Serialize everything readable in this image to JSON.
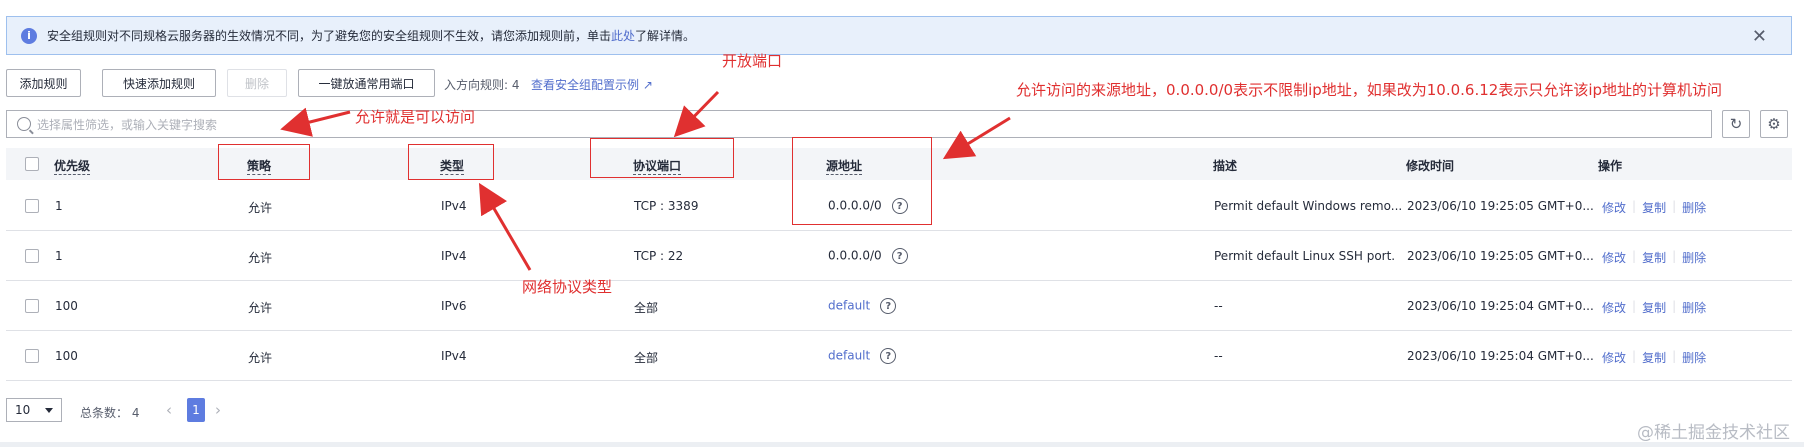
{
  "notice": {
    "text": "安全组规则对不同规格云服务器的生效情况不同，为了避免您的安全组规则不生效，请您添加规则前，单击",
    "link": "此处",
    "suffix": "了解详情。"
  },
  "toolbar": {
    "add_rule": "添加规则",
    "quick_add_rule": "快速添加规则",
    "delete": "删除",
    "one_click_open": "一键放通常用端口",
    "inbound_count": "入方向规则: 4",
    "example_link": "查看安全组配置示例"
  },
  "search": {
    "placeholder": "选择属性筛选，或输入关键字搜索"
  },
  "table": {
    "headers": {
      "priority": "优先级",
      "policy": "策略",
      "type": "类型",
      "port": "协议端口",
      "source": "源地址",
      "desc": "描述",
      "modified": "修改时间",
      "ops": "操作"
    },
    "rows": [
      {
        "priority": "1",
        "policy": "允许",
        "type": "IPv4",
        "port": "TCP : 3389",
        "source": "0.0.0.0/0",
        "source_is_link": false,
        "desc": "Permit default Windows remo...",
        "modified": "2023/06/10 19:25:05 GMT+0...",
        "edit": "修改",
        "copy": "复制",
        "del": "删除"
      },
      {
        "priority": "1",
        "policy": "允许",
        "type": "IPv4",
        "port": "TCP : 22",
        "source": "0.0.0.0/0",
        "source_is_link": false,
        "desc": "Permit default Linux SSH port.",
        "modified": "2023/06/10 19:25:05 GMT+0...",
        "edit": "修改",
        "copy": "复制",
        "del": "删除"
      },
      {
        "priority": "100",
        "policy": "允许",
        "type": "IPv6",
        "port": "全部",
        "source": "default",
        "source_is_link": true,
        "desc": "--",
        "modified": "2023/06/10 19:25:04 GMT+0...",
        "edit": "修改",
        "copy": "复制",
        "del": "删除"
      },
      {
        "priority": "100",
        "policy": "允许",
        "type": "IPv4",
        "port": "全部",
        "source": "default",
        "source_is_link": true,
        "desc": "--",
        "modified": "2023/06/10 19:25:04 GMT+0...",
        "edit": "修改",
        "copy": "复制",
        "del": "删除"
      }
    ]
  },
  "pagination": {
    "page_size": "10",
    "total": "总条数： 4",
    "current_page": "1"
  },
  "annotations": {
    "open_port": "开放端口",
    "allow_means_access": "允许就是可以访问",
    "source_explain": "允许访问的来源地址，0.0.0.0/0表示不限制ip地址，如果改为10.0.6.12表示只允许该ip地址的计算机访问",
    "protocol_type": "网络协议类型"
  },
  "watermark": "@稀土掘金技术社区",
  "colors": {
    "accent": "#526ecc",
    "annotation": "#e03030",
    "notice_bg": "#e8f0fb"
  }
}
